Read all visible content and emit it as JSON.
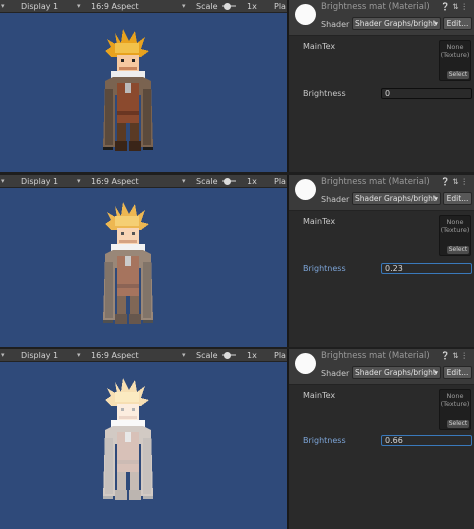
{
  "panels": [
    {
      "game_toolbar": {
        "display": "Display 1",
        "aspect": "16:9 Aspect",
        "scale_label": "Scale",
        "scale_value": "1x",
        "play_label": "Pla"
      },
      "inspector": {
        "title": "Brightness mat (Material)",
        "shader_label": "Shader",
        "shader_value": "Shader Graphs/bright",
        "edit_label": "Edit...",
        "maintex_label": "MainTex",
        "texture_none": "None\n(Texture)",
        "select_label": "Select",
        "brightness_label": "Brightness",
        "brightness_value": "0"
      },
      "brightness": 0
    },
    {
      "game_toolbar": {
        "display": "Display 1",
        "aspect": "16:9 Aspect",
        "scale_label": "Scale",
        "scale_value": "1x",
        "play_label": "Pla"
      },
      "inspector": {
        "title": "Brightness mat (Material)",
        "shader_label": "Shader",
        "shader_value": "Shader Graphs/bright",
        "edit_label": "Edit...",
        "maintex_label": "MainTex",
        "texture_none": "None\n(Texture)",
        "select_label": "Select",
        "brightness_label": "Brightness",
        "brightness_value": "0.23"
      },
      "brightness": 0.23
    },
    {
      "game_toolbar": {
        "display": "Display 1",
        "aspect": "16:9 Aspect",
        "scale_label": "Scale",
        "scale_value": "1x",
        "play_label": "Pla"
      },
      "inspector": {
        "title": "Brightness mat (Material)",
        "shader_label": "Shader",
        "shader_value": "Shader Graphs/bright",
        "edit_label": "Edit...",
        "maintex_label": "MainTex",
        "texture_none": "None\n(Texture)",
        "select_label": "Select",
        "brightness_label": "Brightness",
        "brightness_value": "0.66"
      },
      "brightness": 0.66
    }
  ],
  "colors": {
    "game_background": "#2f4a7a",
    "inspector_background": "#2a2a2a",
    "focus_label": "#7da5d8",
    "focus_border": "#3a79bb"
  },
  "icons": {
    "toolbar_dropdown": "dropdown-arrow-icon",
    "material_preview": "sphere-preview-icon",
    "help": "help-icon",
    "presets": "presets-icon",
    "menu": "kebab-menu-icon"
  }
}
